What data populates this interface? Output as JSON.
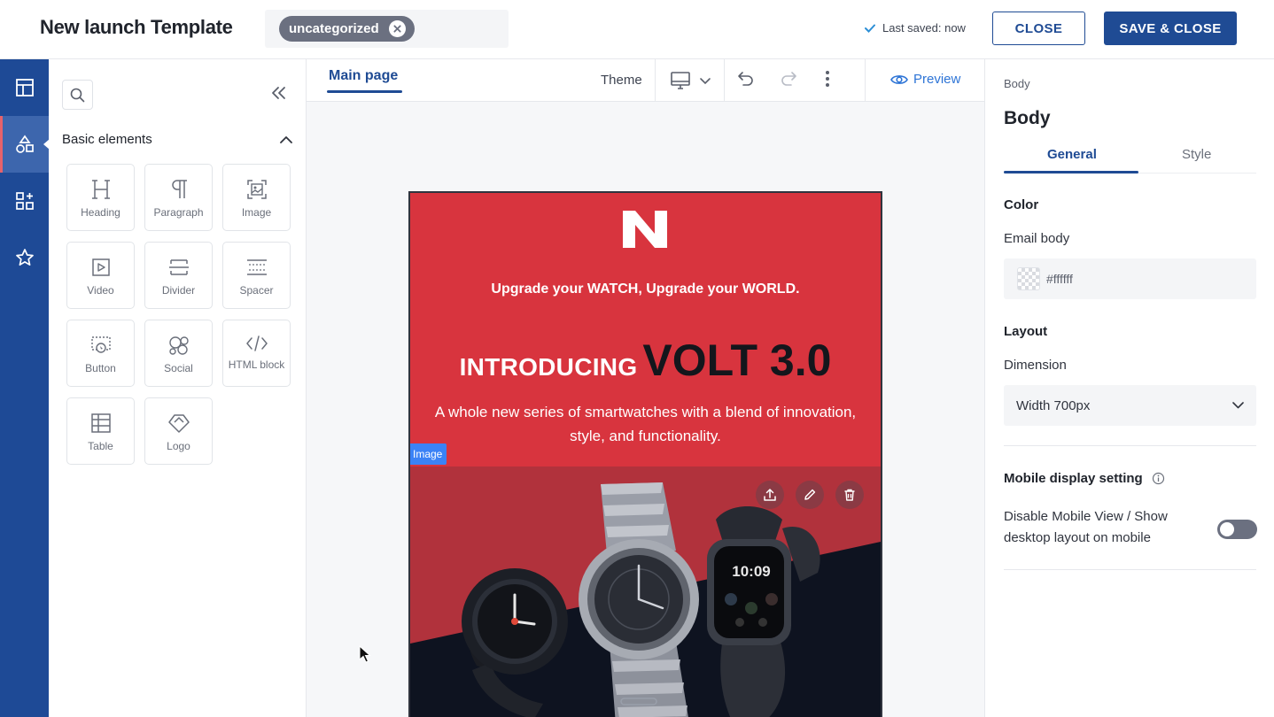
{
  "header": {
    "title": "New launch Template",
    "tag": "uncategorized",
    "saved_status": "Last saved: now",
    "close_label": "CLOSE",
    "save_close_label": "SAVE & CLOSE",
    "accent_color": "#1f4b94"
  },
  "rail": {
    "items": [
      {
        "icon": "layout-icon",
        "active": false
      },
      {
        "icon": "shapes-icon",
        "active": true
      },
      {
        "icon": "add-block-icon",
        "active": false
      },
      {
        "icon": "star-icon",
        "active": false
      }
    ]
  },
  "elements_panel": {
    "section_title": "Basic elements",
    "tiles": [
      {
        "label": "Heading",
        "icon": "heading-icon"
      },
      {
        "label": "Paragraph",
        "icon": "paragraph-icon"
      },
      {
        "label": "Image",
        "icon": "image-icon"
      },
      {
        "label": "Video",
        "icon": "video-icon"
      },
      {
        "label": "Divider",
        "icon": "divider-icon"
      },
      {
        "label": "Spacer",
        "icon": "spacer-icon"
      },
      {
        "label": "Button",
        "icon": "button-icon"
      },
      {
        "label": "Social",
        "icon": "social-icon"
      },
      {
        "label": "HTML block",
        "icon": "code-icon"
      },
      {
        "label": "Table",
        "icon": "table-icon"
      },
      {
        "label": "Logo",
        "icon": "logo-icon"
      }
    ]
  },
  "canvas": {
    "tab": "Main page",
    "theme_label": "Theme",
    "preview_label": "Preview",
    "email": {
      "tagline": "Upgrade your WATCH, Upgrade your WORLD.",
      "headline_intro": "INTRODUCING",
      "headline_product": "VOLT 3.0",
      "description": "A whole new series of smartwatches with a blend of innovation, style, and functionality.",
      "selected_label": "Image",
      "watch_time": "10:09",
      "background_color": "#d8343e"
    }
  },
  "settings_panel": {
    "breadcrumb": "Body",
    "title": "Body",
    "tabs": [
      "General",
      "Style"
    ],
    "color_section": "Color",
    "email_body_label": "Email body",
    "email_body_value": "#ffffff",
    "layout_section": "Layout",
    "dimension_label": "Dimension",
    "dimension_value": "Width 700px",
    "mobile_section": "Mobile display setting",
    "mobile_toggle_label": "Disable Mobile View / Show desktop layout on mobile",
    "mobile_toggle_on": false
  }
}
